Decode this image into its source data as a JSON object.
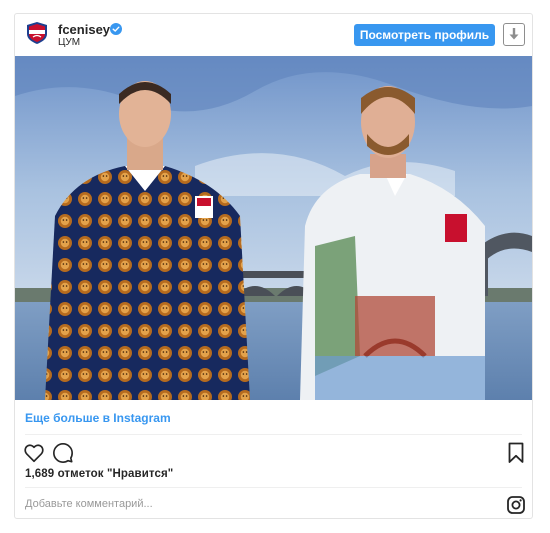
{
  "header": {
    "username": "fcenisey",
    "location": "ЦУМ",
    "view_profile_label": "Посмотреть профиль",
    "verified_icon": "verified-badge-icon",
    "download_icon": "download-arrow-icon"
  },
  "post": {
    "more_link": "Еще больше в Instagram",
    "likes_text": "1,689 отметок \"Нравится\"",
    "comment_placeholder": "Добавьте комментарий...",
    "icons": [
      "heart-icon",
      "comment-icon",
      "bookmark-icon",
      "instagram-icon"
    ]
  },
  "colors": {
    "accent": "#3897f0",
    "text": "#262626",
    "muted": "#999999",
    "border": "#e3e3e3"
  }
}
